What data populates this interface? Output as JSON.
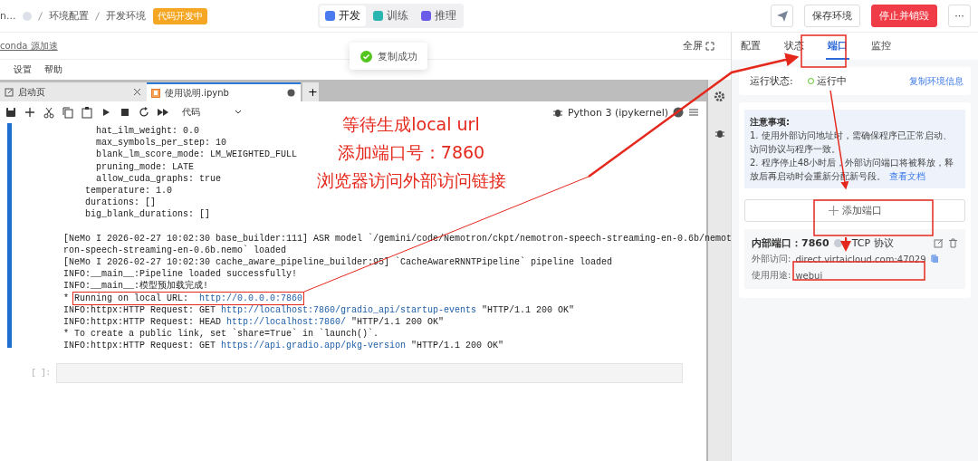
{
  "header": {
    "breadcrumbs": [
      "n...",
      "环境配置",
      "开发环境"
    ],
    "status_badge": "代码开发中",
    "mode_tabs": [
      {
        "label": "开发",
        "selected": true
      },
      {
        "label": "训练",
        "selected": false
      },
      {
        "label": "推理",
        "selected": false
      }
    ],
    "save_button": "保存环境",
    "stop_button": "停止并销毁",
    "more_button": "···"
  },
  "toast": "复制成功",
  "subbar": {
    "link": "conda 源加速",
    "fullscreen": "全屏"
  },
  "menu": [
    "设置",
    "帮助"
  ],
  "notebook_tabs": [
    {
      "label": "启动页",
      "selected": false,
      "kind": "launcher"
    },
    {
      "label": "使用说明.ipynb",
      "selected": true,
      "kind": "notebook"
    }
  ],
  "new_tab": "+",
  "toolbar": {
    "cell_type": "代码",
    "kernel": "Python 3 (ipykernel)"
  },
  "output_lines": [
    [
      {
        "kind": "text",
        "text": "      hat_ilm_weight: 0.0"
      }
    ],
    [
      {
        "kind": "text",
        "text": "      max_symbols_per_step: 10"
      }
    ],
    [
      {
        "kind": "text",
        "text": "      blank_lm_score_mode: LM_WEIGHTED_FULL"
      }
    ],
    [
      {
        "kind": "text",
        "text": "      pruning_mode: LATE"
      }
    ],
    [
      {
        "kind": "text",
        "text": "      allow_cuda_graphs: true"
      }
    ],
    [
      {
        "kind": "text",
        "text": "    temperature: 1.0"
      }
    ],
    [
      {
        "kind": "text",
        "text": "    durations: []"
      }
    ],
    [
      {
        "kind": "text",
        "text": "    big_blank_durations: []"
      }
    ]
  ],
  "log_lines": [
    [
      {
        "kind": "text",
        "text": "[NeMo I 2026-02-27 10:02:30 base_builder:111] ASR model `/gemini/code/Nemotron/ckpt/nemotron-speech-streaming-en-0.6b/nemot"
      }
    ],
    [
      {
        "kind": "text",
        "text": "ron-speech-streaming-en-0.6b.nemo` loaded"
      }
    ],
    [
      {
        "kind": "text",
        "text": "[NeMo I 2026-02-27 10:02:30 cache_aware_pipeline_builder:95] `CacheAwareRNNTPipeline` pipeline loaded"
      }
    ],
    [
      {
        "kind": "text",
        "text": "INFO:__main__:Pipeline loaded successfully!"
      }
    ],
    [
      {
        "kind": "text",
        "text": "INFO:__main__:模型预加载完成!"
      }
    ],
    [
      {
        "kind": "text",
        "text": "* "
      },
      {
        "kind": "highlight",
        "children": [
          {
            "kind": "text",
            "text": "Running on local URL:  "
          },
          {
            "kind": "link",
            "text": "http://0.0.0.0:7860"
          }
        ]
      }
    ],
    [
      {
        "kind": "text",
        "text": "INFO:httpx:HTTP Request: GET "
      },
      {
        "kind": "link",
        "text": "http://localhost:7860/gradio_api/startup-events"
      },
      {
        "kind": "text",
        "text": " \"HTTP/1.1 200 OK\""
      }
    ],
    [
      {
        "kind": "text",
        "text": "INFO:httpx:HTTP Request: HEAD "
      },
      {
        "kind": "link",
        "text": "http://localhost:7860/"
      },
      {
        "kind": "text",
        "text": " \"HTTP/1.1 200 OK\""
      }
    ],
    [
      {
        "kind": "text",
        "text": "* To create a public link, set `share=True` in `launch()`."
      }
    ],
    [
      {
        "kind": "text",
        "text": "INFO:httpx:HTTP Request: GET "
      },
      {
        "kind": "link",
        "text": "https://api.gradio.app/pkg-version"
      },
      {
        "kind": "text",
        "text": " \"HTTP/1.1 200 OK\""
      }
    ]
  ],
  "empty_cell_prompt": "[ ]:",
  "panel": {
    "tabs": [
      {
        "label": "配置",
        "selected": false
      },
      {
        "label": "状态",
        "selected": false
      },
      {
        "label": "端口",
        "selected": true
      },
      {
        "label": "监控",
        "selected": false
      }
    ],
    "status_label": "运行状态:",
    "status_value": "运行中",
    "copy_link": "复制环境信息",
    "notice_title": "注意事项:",
    "notice_items": [
      "1. 使用外部访问地址时，需确保程序已正常启动、访问协议与程序一致。",
      "2. 程序停止48小时后，外部访问端口将被释放，释放后再启动时会重新分配新号段。"
    ],
    "doc_link": "查看文档",
    "add_port": "添加端口",
    "port": {
      "internal": "内部端口：7860",
      "protocol": "TCP 协议",
      "external_label": "外部访问:",
      "external_value": "direct.virtaicloud.com:47029",
      "usage_label": "使用用途:",
      "usage_value": "webui"
    }
  },
  "annotations": [
    "等待生成local url",
    "添加端口号：7860",
    "浏览器访问外部访问链接"
  ]
}
